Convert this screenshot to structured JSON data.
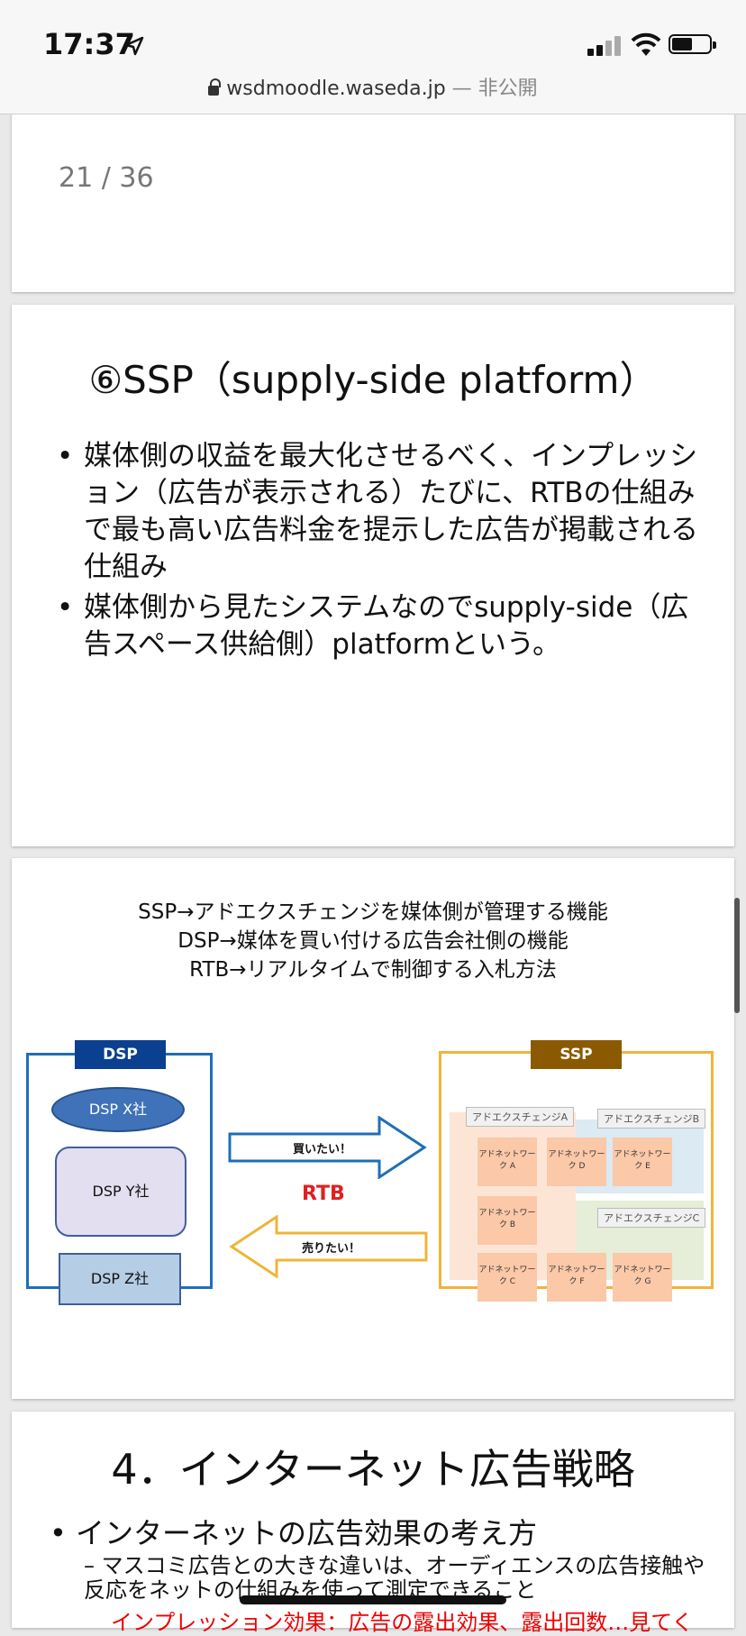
{
  "status": {
    "time": "17:37",
    "url": "wsdmoodle.waseda.jp",
    "url_sep": " — ",
    "privacy": "非公開"
  },
  "slide1": {
    "page_number": "21 / 36"
  },
  "slide2": {
    "title": "⑥SSP（supply-side platform）",
    "bullets": [
      "媒体側の収益を最大化させるべく、インプレッション（広告が表示される）たびに、RTBの仕組みで最も高い広告料金を提示した広告が掲載される仕組み",
      "媒体側から見たシステムなのでsupply-side（広告スペース供給側）platformという。"
    ]
  },
  "slide3": {
    "captions": [
      "SSP→アドエクスチェンジを媒体側が管理する機能",
      "DSP→媒体を買い付ける広告会社側の機能",
      "RTB→リアルタイムで制御する入札方法"
    ],
    "dsp": {
      "label": "DSP",
      "companies": [
        "DSP X社",
        "DSP Y社",
        "DSP Z社"
      ]
    },
    "ssp": {
      "label": "SSP",
      "exchanges": [
        "アドエクスチェンジA",
        "アドエクスチェンジB",
        "アドエクスチェンジC"
      ],
      "networks": [
        "アドネットワーク A",
        "アドネットワーク D",
        "アドネットワーク E",
        "アドネットワーク B",
        "アドネットワーク C",
        "アドネットワーク F",
        "アドネットワーク G"
      ]
    },
    "buy_label": "買いたい！",
    "sell_label": "売りたい！",
    "rtb_label": "RTB",
    "colors": {
      "dsp_blue": "#1f6fb5",
      "dsp_header": "#0b3f8f",
      "ssp_orange": "#f0b43a",
      "ssp_header": "#8b5a00",
      "rtb_red": "#e02020"
    }
  },
  "slide4": {
    "title": "4．インターネット広告戦略",
    "bullet": "• インターネットの広告効果の考え方",
    "sub_bullet": "– マスコミ広告との大きな違いは、オーディエンスの広告接触や反応をネットの仕組みを使って測定できること",
    "red_text": "インプレッション効果：広告の露出効果、露出回数…見てく"
  }
}
